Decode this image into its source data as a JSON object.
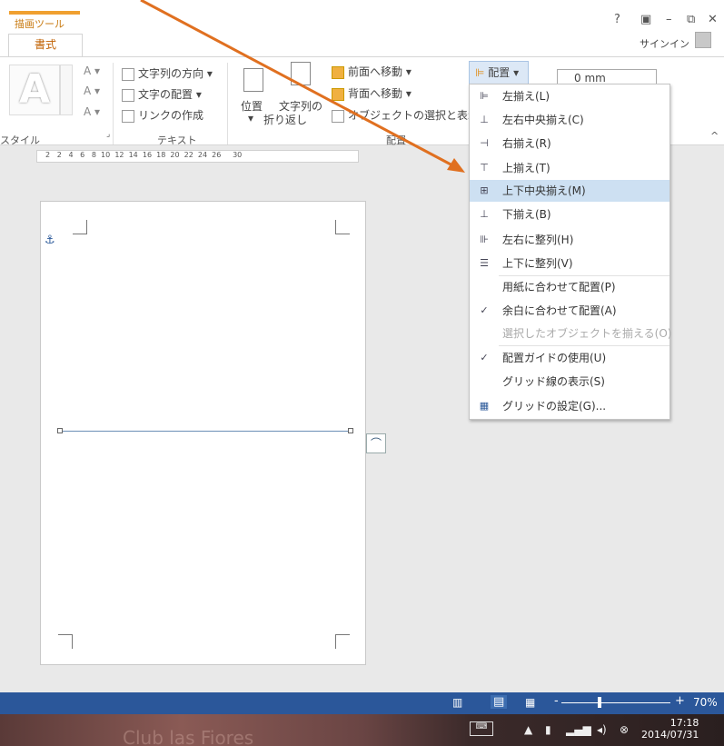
{
  "title_area": {
    "context_tab": "描画ツール",
    "active_tab": "書式",
    "help": "?",
    "ribbon_display": "▣",
    "minimize": "–",
    "restore": "⧉",
    "close": "✕",
    "signin": "サインイン"
  },
  "ribbon": {
    "text_items": [
      "文字列の方向",
      "文字の配置",
      "リンクの作成"
    ],
    "group_labels": {
      "style": "スタイル",
      "text": "テキスト",
      "arrange": "配置"
    },
    "position": "位置",
    "wrap_text": [
      "文字列の",
      "折り返し"
    ],
    "bring_forward": "前面へ移動",
    "send_backward": "背面へ移動",
    "selection_pane": "オブジェクトの選択と表示",
    "arrange_button": "配置",
    "size_value": "0 mm"
  },
  "ruler": {
    "labels": "2   2   4   6   8  10  12  14  16  18  20  22  24  26     30"
  },
  "menu": {
    "items": [
      {
        "icon": "align-left-icon",
        "glyph": "⊫",
        "label": "左揃え(L)"
      },
      {
        "icon": "align-center-icon",
        "glyph": "⊥",
        "label": "左右中央揃え(C)"
      },
      {
        "icon": "align-right-icon",
        "glyph": "⊣",
        "label": "右揃え(R)"
      },
      {
        "icon": "align-top-icon",
        "glyph": "⊤",
        "label": "上揃え(T)"
      },
      {
        "icon": "align-middle-icon",
        "glyph": "⊞",
        "label": "上下中央揃え(M)"
      },
      {
        "icon": "align-bottom-icon",
        "glyph": "⊥",
        "label": "下揃え(B)"
      },
      {
        "icon": "distribute-horizontal-icon",
        "glyph": "⊪",
        "label": "左右に整列(H)"
      },
      {
        "icon": "distribute-vertical-icon",
        "glyph": "☰",
        "label": "上下に整列(V)"
      },
      {
        "icon": "",
        "glyph": "",
        "label": "用紙に合わせて配置(P)"
      },
      {
        "icon": "check-icon",
        "glyph": "✓",
        "label": "余白に合わせて配置(A)"
      },
      {
        "icon": "",
        "glyph": "",
        "label": "選択したオブジェクトを揃える(O)"
      },
      {
        "icon": "check-icon",
        "glyph": "✓",
        "label": "配置ガイドの使用(U)"
      },
      {
        "icon": "",
        "glyph": "",
        "label": "グリッド線の表示(S)"
      },
      {
        "icon": "grid-icon",
        "glyph": "▦",
        "label": "グリッドの設定(G)..."
      }
    ],
    "highlighted_index": 4,
    "disabled_index": 10
  },
  "status": {
    "zoom": "70%"
  },
  "taskbar": {
    "time": "17:18",
    "date": "2014/07/31",
    "watermark": "Club las Fiores"
  }
}
